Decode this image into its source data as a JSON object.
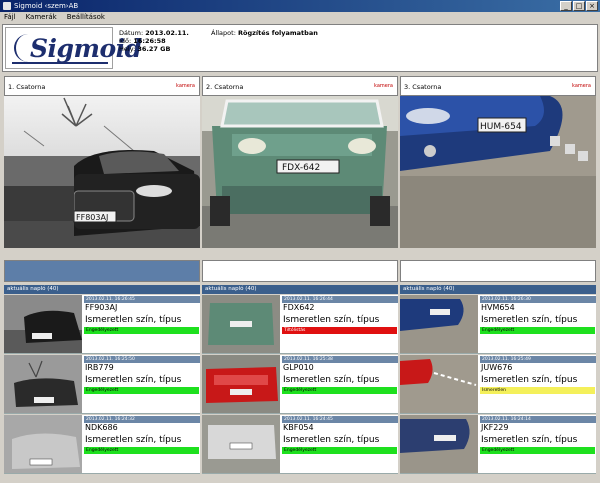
{
  "window": {
    "title": "Sigmoid ‹szem›AB",
    "buttons": [
      "_",
      "□",
      "×"
    ]
  },
  "menu": [
    "Fájl",
    "Kamerák",
    "Beállítások"
  ],
  "header": {
    "logo_text": "Sigmoid",
    "date_label": "Dátum:",
    "date_value": "2013.02.11.",
    "time_label": "Idő:",
    "time_value": "16:26:58",
    "disk_label": "Hely:",
    "disk_value": "36.27 GB",
    "state_label": "Állapot:",
    "state_value": "Rögzítés folyamatban"
  },
  "cameras": [
    {
      "name": "1. Csatorna",
      "btn": "kamera",
      "list_title": "aktuális napló (40)",
      "detections": [
        {
          "ts": "2013.02.11. 16:26:45",
          "plate": "FF903AJ",
          "type": "Ismeretlen szín, típus",
          "status": "Engedélyezett",
          "color": "green"
        },
        {
          "ts": "2013.02.11. 16:25:50",
          "plate": "IRB779",
          "type": "Ismeretlen szín, típus",
          "status": "Engedélyezett",
          "color": "green"
        },
        {
          "ts": "2013.02.11. 16:24:32",
          "plate": "NDK686",
          "type": "Ismeretlen szín, típus",
          "status": "Engedélyezett",
          "color": "green"
        }
      ]
    },
    {
      "name": "2. Csatorna",
      "btn": "kamera",
      "list_title": "aktuális napló (40)",
      "detections": [
        {
          "ts": "2013.02.11. 16:26:44",
          "plate": "FDX642",
          "type": "Ismeretlen szín, típus",
          "status": "Tiltólistás",
          "color": "red"
        },
        {
          "ts": "2013.02.11. 16:25:38",
          "plate": "GLP010",
          "type": "Ismeretlen szín, típus",
          "status": "Engedélyezett",
          "color": "green"
        },
        {
          "ts": "2013.02.11. 16:24:45",
          "plate": "KBF054",
          "type": "Ismeretlen szín, típus",
          "status": "Engedélyezett",
          "color": "green"
        }
      ]
    },
    {
      "name": "3. Csatorna",
      "btn": "kamera",
      "list_title": "aktuális napló (40)",
      "detections": [
        {
          "ts": "2013.02.11. 16:26:30",
          "plate": "HVM654",
          "type": "Ismeretlen szín, típus",
          "status": "Engedélyezett",
          "color": "green"
        },
        {
          "ts": "2013.02.11. 16:25:49",
          "plate": "JUW676",
          "type": "Ismeretlen szín, típus",
          "status": "Ismeretlen",
          "color": "yellow"
        },
        {
          "ts": "2013.02.11. 16:24:14",
          "plate": "JKF229",
          "type": "Ismeretlen szín, típus",
          "status": "Engedélyezett",
          "color": "green"
        }
      ]
    }
  ],
  "feed_plates": [
    "FF803AJ",
    "FDX-642",
    "HUM-654"
  ]
}
